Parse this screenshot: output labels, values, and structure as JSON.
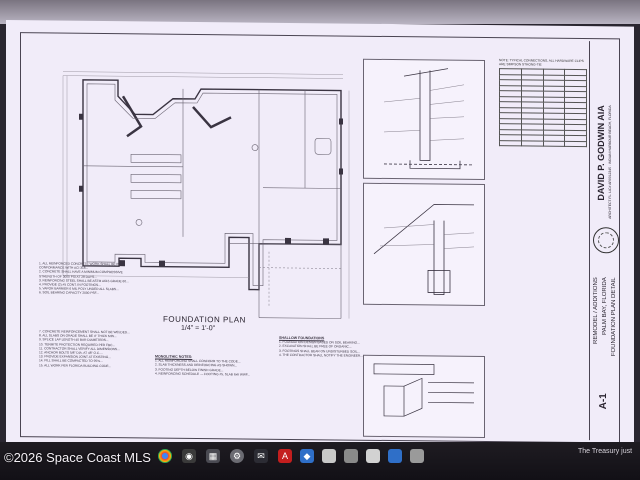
{
  "watermark": "©2026 Space Coast MLS",
  "sheet": {
    "plan_title": "FOUNDATION PLAN",
    "plan_scale": "1/4\" = 1'-0\"",
    "notes_heading_1": "MONOLITHIC NOTES:",
    "notes_heading_2": "SHALLOW FOUNDATIONS",
    "schedule_header": "NOTE: TYPICAL CONNECTIONS, ALL HARDWARE CLIPS ARE SIMPSON STRONG-TIE",
    "title_block": {
      "architect": "DAVID P. GODWIN AIA",
      "architect_sub": "ARCHITECT FL. LIC# AR0012345 · INDIAN HARBOUR BEACH, FLORIDA",
      "project": "REMODEL / ADDITIONS",
      "address": "PALM BAY, FLORIDA",
      "sheet_name": "FOUNDATION PLAN DETAIL",
      "sheet_no": "A-1"
    }
  },
  "taskbar": {
    "news_text": "The Treasury just",
    "icons": [
      "chrome-icon",
      "camera-icon",
      "calendar-icon",
      "settings-icon",
      "mail-icon",
      "acrobat-icon",
      "app-icon",
      "app-icon",
      "app-icon",
      "app-icon",
      "app-icon",
      "app-icon"
    ]
  },
  "colors": {
    "paper": "#f1ecf9",
    "ink": "#2a2430",
    "taskbar": "#121016"
  }
}
